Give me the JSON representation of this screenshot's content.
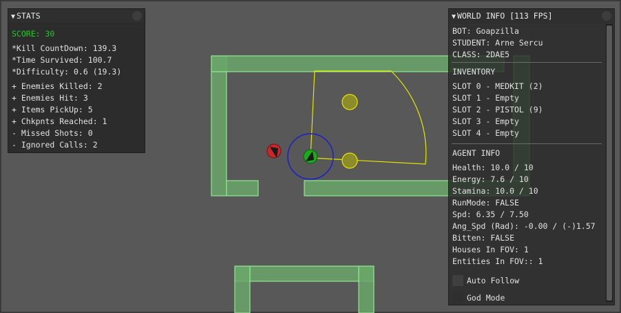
{
  "stats": {
    "title": "STATS",
    "score": "SCORE: 30",
    "kill_countdown": "*Kill CountDown: 139.3",
    "time_survived": "*Time Survived: 100.7",
    "difficulty": "*Difficulty: 0.6 (19.3)",
    "enemies_killed": "+ Enemies Killed: 2",
    "enemies_hit": "+ Enemies Hit: 3",
    "items_pickup": "+ Items PickUp: 5",
    "checkpoints": "+ Chkpnts Reached: 1",
    "missed_shots": "- Missed Shots: 0",
    "ignored_calls": "- Ignored Calls: 2"
  },
  "world": {
    "title": "WORLD INFO [113 FPS]",
    "bot": "BOT: Goapzilla",
    "student": "STUDENT: Arne Sercu",
    "class": "CLASS: 2DAE5",
    "inventory_header": "INVENTORY",
    "slots": [
      "SLOT 0 - MEDKIT (2)",
      "SLOT 1 - Empty",
      "SLOT 2 - PISTOL (9)",
      "SLOT 3 - Empty",
      "SLOT 4 - Empty"
    ],
    "agent_header": "AGENT INFO",
    "health": "Health: 10.0 / 10",
    "energy": "Energy: 7.6 / 10",
    "stamina": "Stamina: 10.0 / 10",
    "runmode": "RunMode: FALSE",
    "speed": "Spd: 6.35 / 7.50",
    "ang_speed": "Ang_Spd (Rad): -0.00 / (-)1.57",
    "bitten": "Bitten: FALSE",
    "houses_fov": "Houses In FOV: 1",
    "entities_fov": "Entities In FOV:: 1",
    "auto_follow": "Auto Follow",
    "god_mode": "God Mode"
  },
  "colors": {
    "background": "#585858",
    "wall_fill": "#6aa66a",
    "wall_stroke": "#9cff9c",
    "fov_cone": "#e6e600",
    "agent_fill": "#1ea81e",
    "enemy_fill": "#c82828",
    "range_circle": "#1e1ec8",
    "item_fill": "#8c8c28",
    "score_text": "#23c823"
  },
  "icons": {
    "collapse": "triangle-down-icon",
    "close": "close-circle-icon"
  }
}
